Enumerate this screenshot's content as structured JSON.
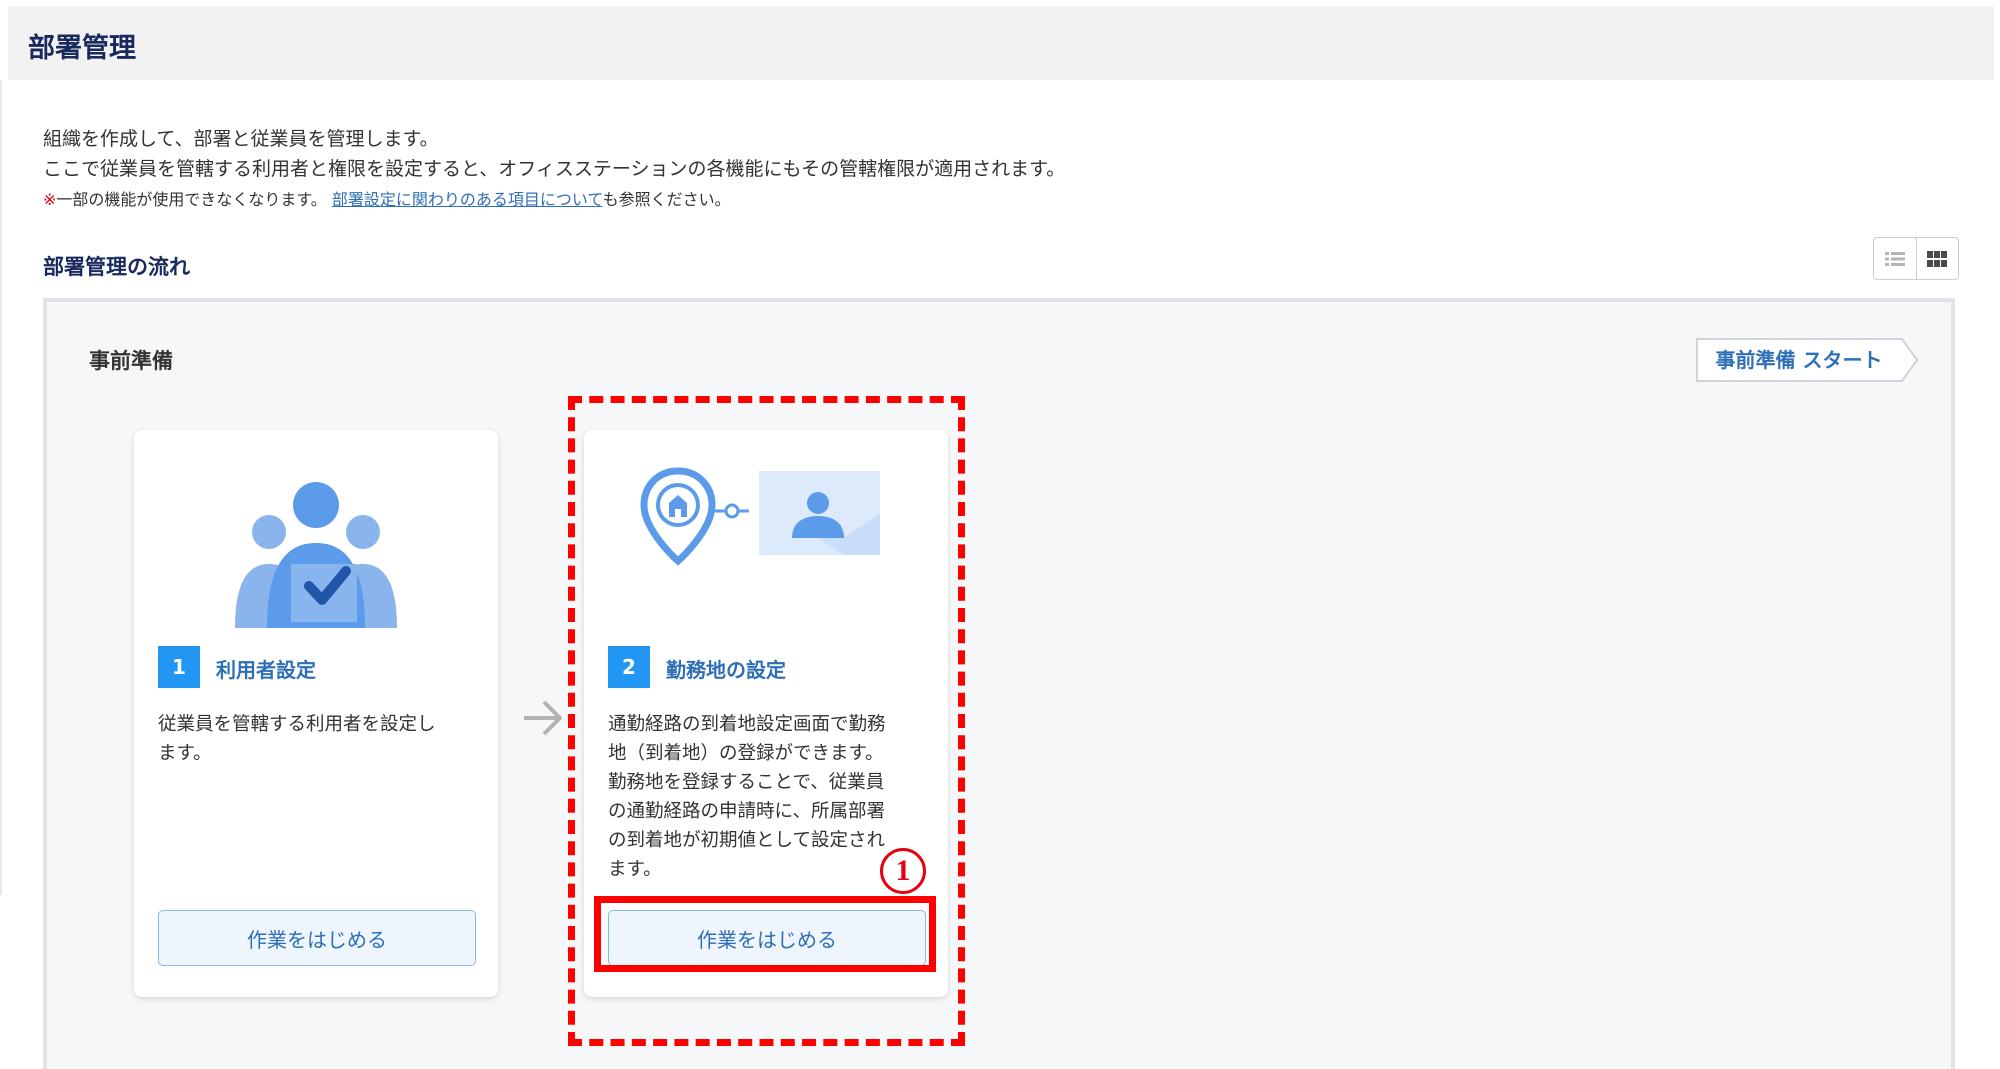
{
  "header": {
    "title": "部署管理"
  },
  "intro": {
    "line1": "組織を作成して、部署と従業員を管理します。",
    "line2": "ここで従業員を管轄する利用者と権限を設定すると、オフィスステーションの各機能にもその管轄権限が適用されます。",
    "note_mark": "※",
    "note_text": "一部の機能が使用できなくなります。",
    "note_link": "部署設定に関わりのある項目について",
    "note_suffix": "も参照ください。"
  },
  "flow": {
    "title": "部署管理の流れ",
    "view_options": [
      "list-view-icon",
      "grid-view-icon"
    ]
  },
  "section": {
    "title": "事前準備",
    "start_label": "事前準備 スタート"
  },
  "steps": [
    {
      "number": "1",
      "title": "利用者設定",
      "desc_lines": [
        "従業員を管轄する利用者を設定し",
        "ます。"
      ],
      "button": "作業をはじめる",
      "icon": "user-check-icon"
    },
    {
      "number": "2",
      "title": "勤務地の設定",
      "desc_lines": [
        "通勤経路の到着地設定画面で勤務",
        "地（到着地）の登録ができます。",
        "勤務地を登録することで、従業員",
        "の通勤経路の申請時に、所属部署",
        "の到着地が初期値として設定され",
        "ます。"
      ],
      "button": "作業をはじめる",
      "icon": "location-profile-icon"
    }
  ],
  "annotation": {
    "label": "1"
  },
  "colors": {
    "accent": "#2196f3",
    "link": "#2f6fb7",
    "highlight": "#ff0000",
    "heading": "#1a2a5e"
  }
}
